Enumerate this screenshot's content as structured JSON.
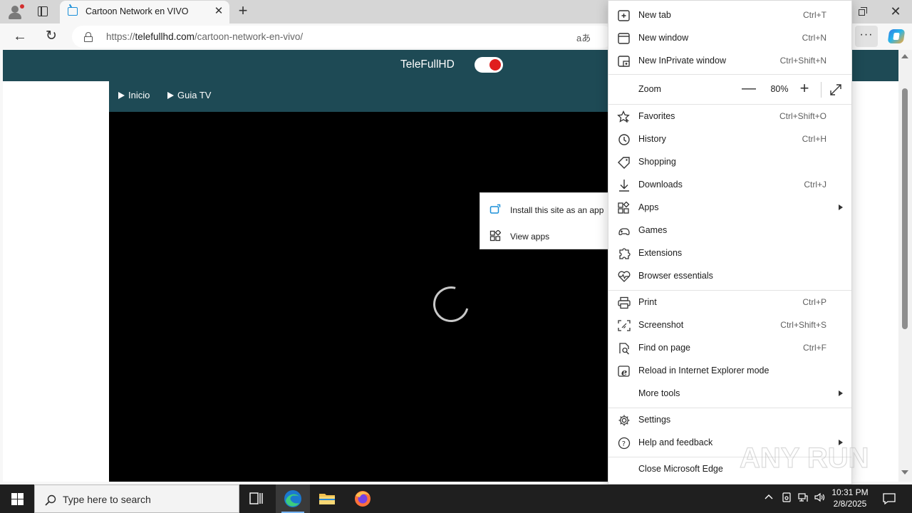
{
  "browser": {
    "tab_title": "Cartoon Network en VIVO",
    "url_scheme": "https://",
    "url_host": "telefullhd.com",
    "url_path": "/cartoon-network-en-vivo/",
    "read_aloud_glyph": "aあ"
  },
  "site": {
    "title": "TeleFullHD",
    "nav": [
      {
        "label": "Inicio"
      },
      {
        "label": "Guia TV"
      }
    ]
  },
  "menu": {
    "items": [
      {
        "label": "New tab",
        "shortcut": "Ctrl+T",
        "icon": "new-tab-icon"
      },
      {
        "label": "New window",
        "shortcut": "Ctrl+N",
        "icon": "new-window-icon"
      },
      {
        "label": "New InPrivate window",
        "shortcut": "Ctrl+Shift+N",
        "icon": "inprivate-icon"
      },
      {
        "label": "Favorites",
        "shortcut": "Ctrl+Shift+O",
        "icon": "star-icon"
      },
      {
        "label": "History",
        "shortcut": "Ctrl+H",
        "icon": "history-icon"
      },
      {
        "label": "Shopping",
        "shortcut": "",
        "icon": "tag-icon"
      },
      {
        "label": "Downloads",
        "shortcut": "Ctrl+J",
        "icon": "download-icon"
      },
      {
        "label": "Apps",
        "shortcut": "",
        "icon": "apps-icon"
      },
      {
        "label": "Games",
        "shortcut": "",
        "icon": "games-icon"
      },
      {
        "label": "Extensions",
        "shortcut": "",
        "icon": "puzzle-icon"
      },
      {
        "label": "Browser essentials",
        "shortcut": "",
        "icon": "heart-pulse-icon"
      },
      {
        "label": "Print",
        "shortcut": "Ctrl+P",
        "icon": "printer-icon"
      },
      {
        "label": "Screenshot",
        "shortcut": "Ctrl+Shift+S",
        "icon": "screenshot-icon"
      },
      {
        "label": "Find on page",
        "shortcut": "Ctrl+F",
        "icon": "find-icon"
      },
      {
        "label": "Reload in Internet Explorer mode",
        "shortcut": "",
        "icon": "ie-icon"
      },
      {
        "label": "More tools",
        "shortcut": "",
        "icon": ""
      },
      {
        "label": "Settings",
        "shortcut": "",
        "icon": "gear-icon"
      },
      {
        "label": "Help and feedback",
        "shortcut": "",
        "icon": "help-icon"
      },
      {
        "label": "Close Microsoft Edge",
        "shortcut": "",
        "icon": ""
      }
    ],
    "zoom": {
      "label": "Zoom",
      "value": "80%"
    }
  },
  "apps_submenu": {
    "items": [
      {
        "label": "Install this site as an app",
        "icon": "install-app-icon"
      },
      {
        "label": "View apps",
        "icon": "view-apps-icon"
      }
    ]
  },
  "watermark": {
    "text": "ANY RUN"
  },
  "taskbar": {
    "search_placeholder": "Type here to search",
    "time": "10:31 PM",
    "date": "2/8/2025"
  },
  "colors": {
    "site_header": "#1e4a55",
    "toggle_knob": "#e01e1e",
    "taskbar": "#1f1f1f"
  }
}
